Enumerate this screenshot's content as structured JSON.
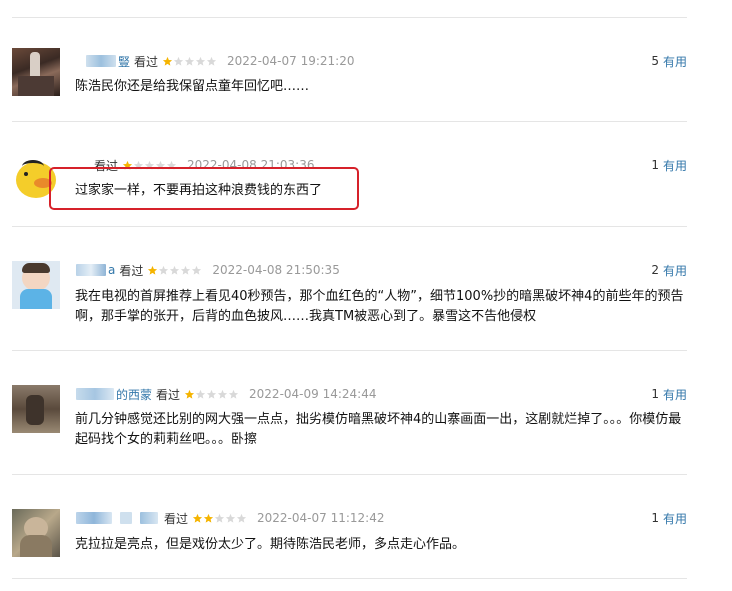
{
  "labels": {
    "seen": "看过",
    "useful": "有用"
  },
  "colors": {
    "link": "#3377aa",
    "star_on": "#f5b400",
    "star_off": "#d9d9d9",
    "highlight": "#d6212a"
  },
  "reviews": [
    {
      "name_visible": "豎",
      "rating": 1,
      "time": "2022-04-07 19:21:20",
      "useful_count": "5",
      "text": "陈浩民你还是给我保留点童年回忆吧……"
    },
    {
      "name_visible": "",
      "rating": 1,
      "time": "2022-04-08 21:03:36",
      "useful_count": "1",
      "text": "过家家一样，不要再拍这种浪费钱的东西了"
    },
    {
      "name_visible": "a",
      "rating": 1,
      "time": "2022-04-08 21:50:35",
      "useful_count": "2",
      "text": "我在电视的首屏推荐上看见40秒预告，那个血红色的“人物”，细节100%抄的暗黑破坏神4的前些年的预告啊，那手掌的张开，后背的血色披风……我真TM被恶心到了。暴雪这不告他侵权"
    },
    {
      "name_visible": "的西蒙",
      "rating": 1,
      "time": "2022-04-09 14:24:44",
      "useful_count": "1",
      "text": "前几分钟感觉还比别的网大强一点点，拙劣模仿暗黑破坏神4的山寨画面一出，这剧就烂掉了。。。你模仿最起码找个女的莉莉丝吧。。。卧擦"
    },
    {
      "name_visible": "",
      "rating": 2,
      "time": "2022-04-07 11:12:42",
      "useful_count": "1",
      "text": "克拉拉是亮点，但是戏份太少了。期待陈浩民老师，多点走心作品。"
    }
  ]
}
